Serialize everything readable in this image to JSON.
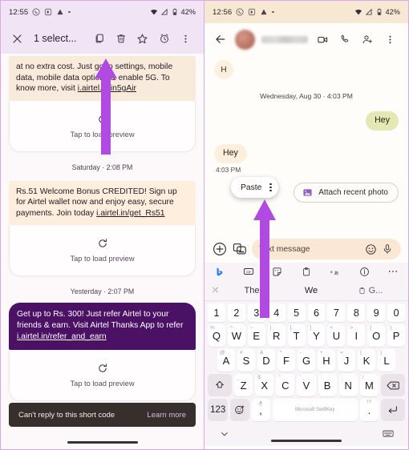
{
  "left_phone": {
    "status_bar": {
      "time": "12:55",
      "battery_pct": "42%",
      "icons": [
        "whatsapp-icon",
        "app-badge-icon",
        "drive-icon",
        "dot-icon",
        "wifi-icon",
        "signal-icon",
        "battery-icon"
      ]
    },
    "selection_bar": {
      "close_label": "✕",
      "title": "1 select...",
      "actions": [
        "copy-icon",
        "delete-icon",
        "star-icon",
        "snooze-icon",
        "overflow-icon"
      ]
    },
    "messages": [
      {
        "id": "msg-5g",
        "type": "incoming",
        "selected": true,
        "text": "at no extra cost. Just go to settings, mobile data, mobile data options & enable 5G. To know more, visit ",
        "link": "i.airtel.in/in5gAir",
        "preview_label": "Tap to load preview"
      },
      {
        "id": "msg-wallet",
        "type": "incoming",
        "day_stamp": "Saturday · 2:08 PM",
        "text": "Rs.51 Welcome Bonus CREDITED! Sign up for Airtel wallet now and enjoy easy, secure payments. Join today ",
        "link": "i.airtel.in/get_Rs51",
        "preview_label": "Tap to load preview"
      },
      {
        "id": "msg-refer",
        "type": "incoming-highlight",
        "day_stamp": "Yesterday · 2:07 PM",
        "text": "Get up to Rs. 300! Just refer Airtel to your friends & earn. Visit Airtel Thanks App to refer ",
        "link": "i.airtel.in/refer_and_earn",
        "preview_label": "Tap to load preview",
        "time": "2:07 PM"
      }
    ],
    "snackbar": {
      "text": "Can't reply to this short code",
      "action": "Learn more"
    }
  },
  "right_phone": {
    "status_bar": {
      "time": "12:56",
      "battery_pct": "42%"
    },
    "app_bar": {
      "back_icon": "back-arrow-icon",
      "contact_name": "",
      "actions": [
        "video-call-icon",
        "phone-call-icon",
        "add-person-icon",
        "overflow-icon"
      ]
    },
    "avatar_letter": "H",
    "conversation": {
      "day_stamp": "Wednesday, Aug 30 · 4:03 PM",
      "messages": [
        {
          "id": "out-hey",
          "type": "outgoing",
          "text": "Hey"
        },
        {
          "id": "in-hey",
          "type": "incoming",
          "text": "Hey",
          "time": "4:03 PM"
        }
      ],
      "suggestion_chip": {
        "icon": "photo-icon",
        "label": "Attach recent photo"
      }
    },
    "paste_popup": {
      "label": "Paste",
      "overflow_icon": "kebab-icon"
    },
    "compose": {
      "plus_icon": "plus-icon",
      "gallery_icon": "gallery-icon",
      "placeholder": "Text message",
      "emoji_icon": "emoji-icon",
      "mic_icon": "mic-icon"
    },
    "keyboard": {
      "toolbar_icons": [
        "bing-icon",
        "gif-icon",
        "sticker-icon",
        "clipboard-icon",
        "translate-icon",
        "info-icon",
        "more-icon"
      ],
      "predictions": {
        "expand": "⤫",
        "items": [
          "The",
          "We"
        ],
        "clipboard_suggestion": "G..."
      },
      "number_row": [
        "1",
        "2",
        "3",
        "4",
        "5",
        "6",
        "7",
        "8",
        "9",
        "0"
      ],
      "row1": [
        {
          "key": "Q",
          "sub": "%"
        },
        {
          "key": "W",
          "sub": "^"
        },
        {
          "key": "E",
          "sub": "~"
        },
        {
          "key": "R",
          "sub": "|"
        },
        {
          "key": "T",
          "sub": "["
        },
        {
          "key": "Y",
          "sub": "]"
        },
        {
          "key": "U",
          "sub": "<"
        },
        {
          "key": "I",
          "sub": ">"
        },
        {
          "key": "O",
          "sub": "{"
        },
        {
          "key": "P",
          "sub": "}"
        }
      ],
      "row2": [
        {
          "key": "A",
          "sub": "@"
        },
        {
          "key": "S",
          "sub": "#"
        },
        {
          "key": "D",
          "sub": "&"
        },
        {
          "key": "F",
          "sub": "*"
        },
        {
          "key": "G",
          "sub": "-"
        },
        {
          "key": "H",
          "sub": "+"
        },
        {
          "key": "J",
          "sub": "="
        },
        {
          "key": "K",
          "sub": "("
        },
        {
          "key": "L",
          "sub": ")"
        }
      ],
      "row3": [
        {
          "key": "Z",
          "sub": "_"
        },
        {
          "key": "X",
          "sub": "$"
        },
        {
          "key": "C",
          "sub": "\""
        },
        {
          "key": "V",
          "sub": "'"
        },
        {
          "key": "B",
          "sub": ":"
        },
        {
          "key": "N",
          "sub": ";"
        },
        {
          "key": "M",
          "sub": "/"
        }
      ],
      "shift_icon": "shift-icon",
      "backspace_icon": "backspace-icon",
      "numeric_key": "123",
      "emoji_key": "emoji-icon",
      "comma_key": ",",
      "comma_sub": "mic-icon",
      "space_label": "Microsoft SwiftKey",
      "period_key": ".",
      "period_sub": "!?",
      "enter_icon": "enter-icon",
      "nav_down_icon": "chevron-down-icon",
      "nav_keyboard_icon": "keyboard-icon"
    }
  },
  "annotations": {
    "arrow_color": "#b14ae0",
    "arrows": [
      "arrow-pointing-to-copy-icon",
      "arrow-pointing-to-paste-popup"
    ]
  }
}
